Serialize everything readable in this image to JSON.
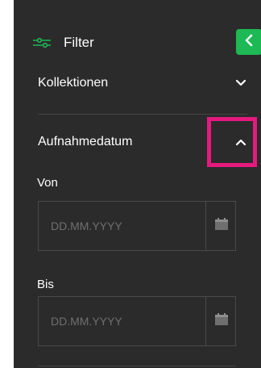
{
  "header": {
    "title": "Filter"
  },
  "sections": {
    "collections": {
      "title": "Kollektionen",
      "state": "collapsed"
    },
    "capture_date": {
      "title": "Aufnahmedatum",
      "state": "expanded",
      "from": {
        "label": "Von",
        "placeholder": "DD.MM.YYYY"
      },
      "to": {
        "label": "Bis",
        "placeholder": "DD.MM.YYYY"
      }
    }
  },
  "colors": {
    "panel": "#2b2b2b",
    "accent": "#1db954",
    "highlight": "#e6197f"
  },
  "icons": {
    "filter": "sliders-icon",
    "collapse": "chevron-left-icon",
    "calendar": "calendar-icon"
  }
}
